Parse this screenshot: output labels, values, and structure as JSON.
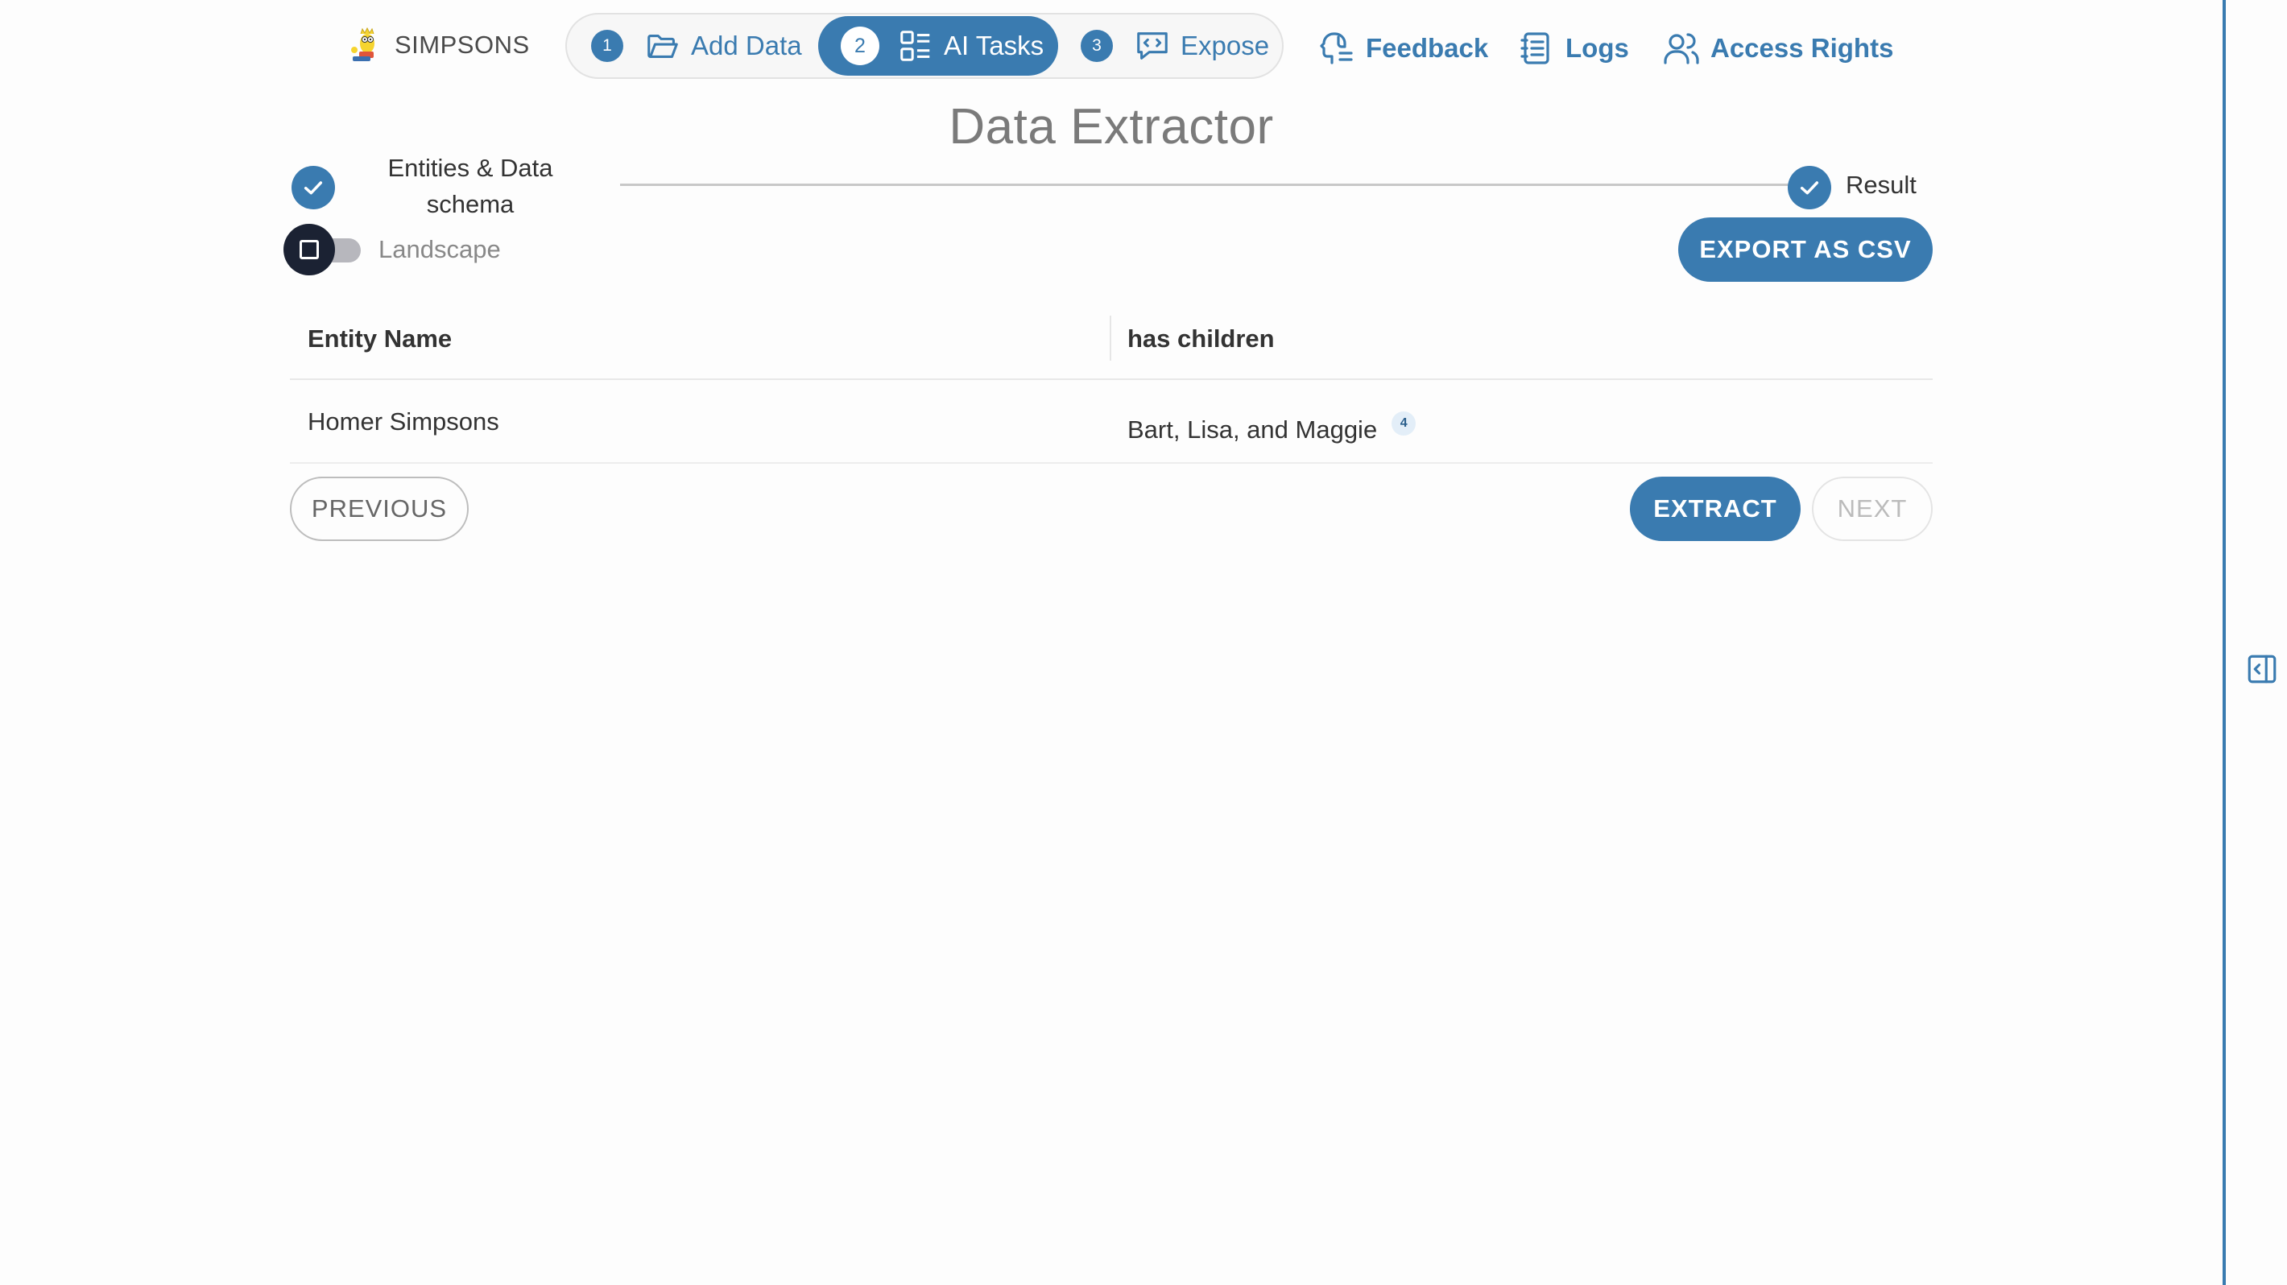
{
  "brand": {
    "name": "SIMPSONS",
    "logo_icon": "simpsons-character-logo"
  },
  "steps": [
    {
      "number": "1",
      "label": "Add Data",
      "icon": "folder-open-icon",
      "active": false
    },
    {
      "number": "2",
      "label": "AI Tasks",
      "icon": "tasks-list-icon",
      "active": true
    },
    {
      "number": "3",
      "label": "Expose",
      "icon": "code-chat-icon",
      "active": false
    }
  ],
  "nav": {
    "feedback": "Feedback",
    "logs": "Logs",
    "access_rights": "Access Rights"
  },
  "page_title": "Data Extractor",
  "stepper": {
    "step1_label": "Entities & Data schema",
    "step2_label": "Result"
  },
  "toggle": {
    "label": "Landscape",
    "checked": false
  },
  "buttons": {
    "export": "EXPORT AS CSV",
    "previous": "PREVIOUS",
    "extract": "EXTRACT",
    "next": "NEXT"
  },
  "table": {
    "headers": [
      "Entity Name",
      "has children"
    ],
    "rows": [
      {
        "entity": "Homer Simpsons",
        "value": "Bart, Lisa, and Maggie",
        "citation": "4"
      }
    ]
  },
  "colors": {
    "accent": "#3a7bb0",
    "toggle_thumb": "#1b2233",
    "title": "#7a7a7a"
  }
}
